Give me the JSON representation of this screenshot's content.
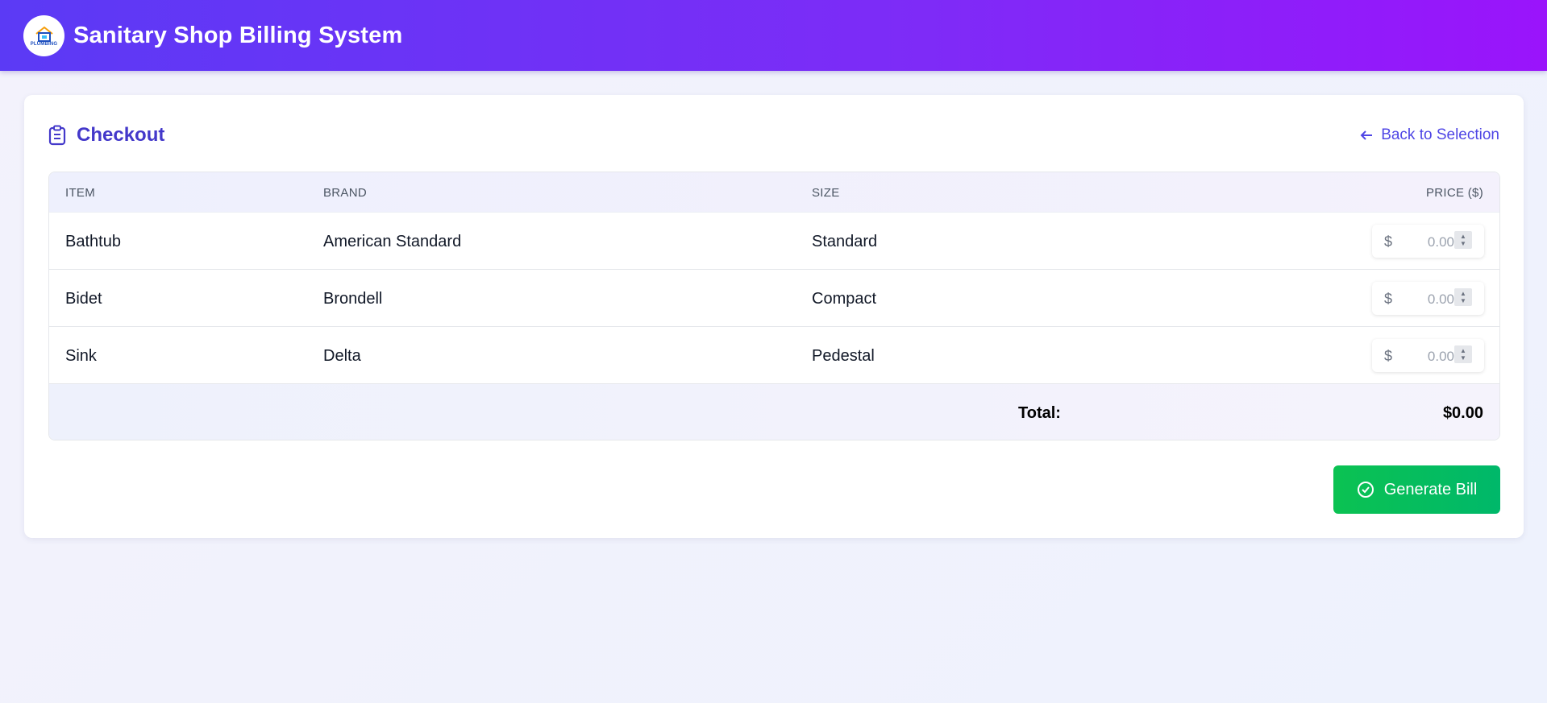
{
  "header": {
    "logo_text": "PLUMBING",
    "title": "Sanitary Shop Billing System"
  },
  "checkout": {
    "title": "Checkout",
    "back_link": "Back to Selection",
    "columns": [
      "ITEM",
      "BRAND",
      "SIZE",
      "PRICE ($)"
    ],
    "rows": [
      {
        "item": "Bathtub",
        "brand": "American Standard",
        "size": "Standard",
        "currency": "$",
        "price_placeholder": "0.00"
      },
      {
        "item": "Bidet",
        "brand": "Brondell",
        "size": "Compact",
        "currency": "$",
        "price_placeholder": "0.00"
      },
      {
        "item": "Sink",
        "brand": "Delta",
        "size": "Pedestal",
        "currency": "$",
        "price_placeholder": "0.00"
      }
    ],
    "total_label": "Total:",
    "total_value": "$0.00",
    "generate_button": "Generate Bill"
  },
  "icons": {
    "logo": "house-logo-icon",
    "checkout": "clipboard-icon",
    "back": "arrow-left-icon",
    "generate": "check-circle-icon"
  },
  "colors": {
    "header_start": "#5b3af5",
    "header_end": "#9a14fb",
    "accent": "#4338ca",
    "link": "#4f46e5",
    "button": "#0bc252"
  }
}
